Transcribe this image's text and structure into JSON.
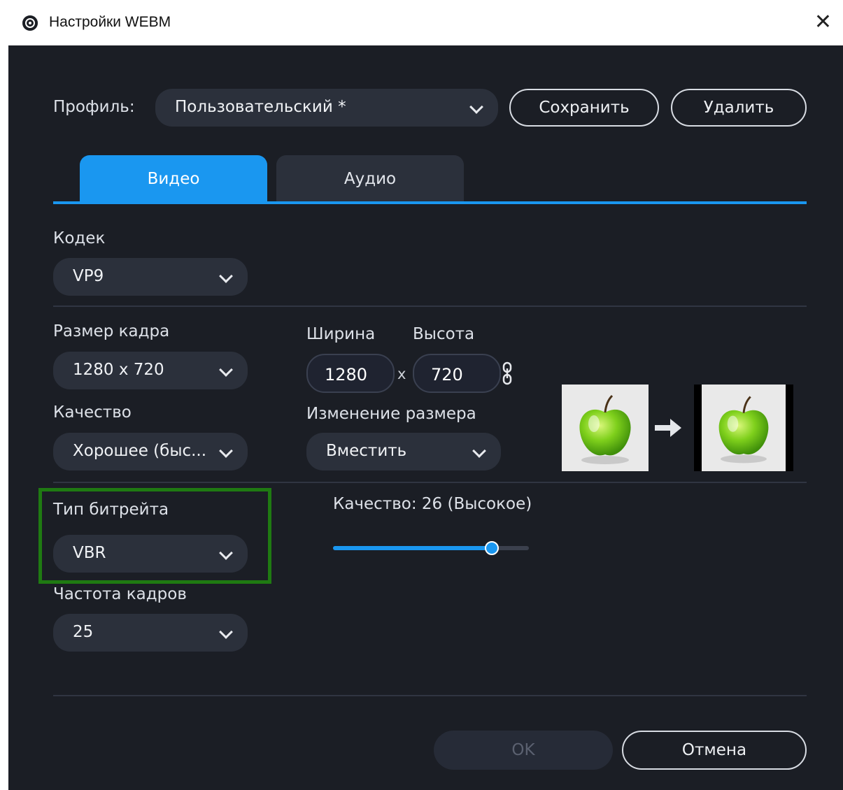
{
  "window": {
    "title": "Настройки WEBM",
    "close_symbol": "✕"
  },
  "profile": {
    "label": "Профиль:",
    "value": "Пользовательский *",
    "save": "Сохранить",
    "delete": "Удалить"
  },
  "tabs": [
    {
      "label": "Видео",
      "active": true
    },
    {
      "label": "Аудио",
      "active": false
    }
  ],
  "codec": {
    "label": "Кодек",
    "value": "VP9"
  },
  "frame_size": {
    "label": "Размер кадра",
    "value": "1280 x 720"
  },
  "dimensions": {
    "width_label": "Ширина",
    "height_label": "Высота",
    "width": "1280",
    "height": "720",
    "separator": "x"
  },
  "quality": {
    "label": "Качество",
    "value": "Хорошее (быс..."
  },
  "resize": {
    "label": "Изменение размера",
    "value": "Вместить"
  },
  "bitrate_type": {
    "label": "Тип битрейта",
    "value": "VBR"
  },
  "quality_slider": {
    "label": "Качество: 26 (Высокое)",
    "fraction": 0.81
  },
  "frame_rate": {
    "label": "Частота кадров",
    "value": "25"
  },
  "footer": {
    "ok": "OK",
    "cancel": "Отмена"
  },
  "colors": {
    "accent": "#1a97f0",
    "background": "#1b1e25",
    "control": "#2b303b",
    "highlight_box": "#1f7a12"
  },
  "icons": [
    "app-logo-icon",
    "close-icon",
    "chevron-down-icon",
    "link-icon",
    "arrow-right-icon",
    "apple-image"
  ]
}
